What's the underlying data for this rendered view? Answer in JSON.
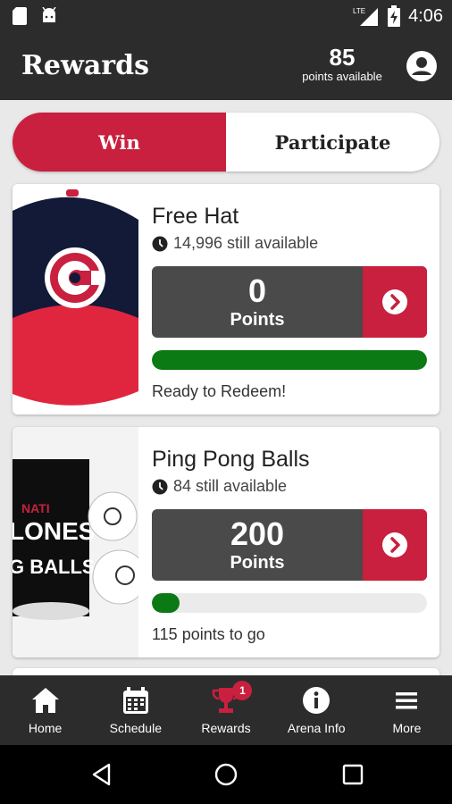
{
  "statusbar": {
    "time": "4:06",
    "network": "LTE"
  },
  "appbar": {
    "title": "Rewards",
    "points": "85",
    "points_label": "points available"
  },
  "tabs": [
    {
      "label": "Win",
      "active": true
    },
    {
      "label": "Participate",
      "active": false
    }
  ],
  "rewards": [
    {
      "name": "Free Hat",
      "availability": "14,996 still available",
      "points_value": "0",
      "points_label": "Points",
      "progress": 1.0,
      "status": "Ready to Redeem!"
    },
    {
      "name": "Ping Pong Balls",
      "availability": "84 still available",
      "points_value": "200",
      "points_label": "Points",
      "progress": 0.1,
      "status": "115 points to go",
      "image_text": [
        "NATI",
        "LONES",
        "G BALLS"
      ]
    }
  ],
  "bottom_nav": [
    {
      "label": "Home",
      "icon": "home-icon"
    },
    {
      "label": "Schedule",
      "icon": "calendar-icon"
    },
    {
      "label": "Rewards",
      "icon": "trophy-icon",
      "badge": "1",
      "active": true
    },
    {
      "label": "Arena Info",
      "icon": "info-icon"
    },
    {
      "label": "More",
      "icon": "menu-icon"
    }
  ],
  "colors": {
    "brand_red": "#c8203e",
    "bar_dark": "#2c2c2c",
    "progress_green": "#0c7a14",
    "redeem_gray": "#4a4a4a"
  }
}
